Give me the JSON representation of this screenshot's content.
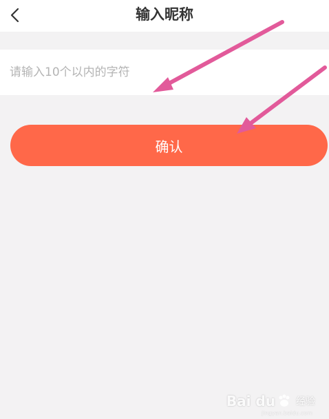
{
  "header": {
    "title": "输入昵称",
    "back_icon": "chevron-left-icon"
  },
  "form": {
    "nickname_placeholder": "请输入10个以内的字符",
    "nickname_value": ""
  },
  "confirm": {
    "label": "确认",
    "color": "#ff6849"
  },
  "annotations": {
    "arrow_color": "#e25a9a"
  },
  "watermark": {
    "brand": "Bai du",
    "sub": "经验",
    "url": "jingyan.baidu.com"
  },
  "colors": {
    "background": "#f3f2f3",
    "surface": "#ffffff",
    "title_text": "#333333",
    "placeholder_text": "#b4b4b4"
  }
}
